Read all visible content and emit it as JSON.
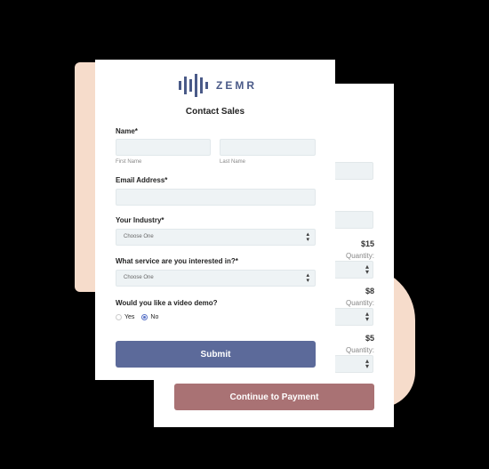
{
  "brand": {
    "name": "ZEMR",
    "color": "#4a5a88"
  },
  "form": {
    "title": "Contact Sales",
    "name_label": "Name*",
    "first_name_caption": "First Name",
    "last_name_caption": "Last Name",
    "first_name_value": "",
    "last_name_value": "",
    "email_label": "Email Address*",
    "email_value": "",
    "industry_label": "Your Industry*",
    "industry_selected": "Choose One",
    "service_label": "What service are you interested in?*",
    "service_selected": "Choose One",
    "demo_question": "Would you like a video demo?",
    "demo_options": [
      {
        "label": "Yes",
        "checked": false
      },
      {
        "label": "No",
        "checked": true
      }
    ],
    "submit_label": "Submit",
    "submit_color": "#5c6a9a"
  },
  "payment": {
    "items": [
      {
        "price": "$15",
        "quantity_label": "Quantity:"
      },
      {
        "price": "$8",
        "quantity_label": "Quantity:"
      },
      {
        "price": "$5",
        "quantity_label": "Quantity:"
      }
    ],
    "continue_label": "Continue to Payment",
    "continue_color": "#a97274"
  },
  "colors": {
    "background": "#000000",
    "accent_blob": "#f6dccb"
  }
}
